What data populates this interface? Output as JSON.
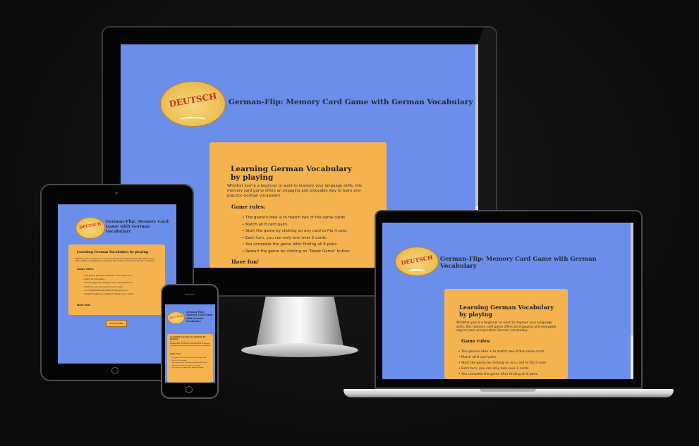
{
  "site": {
    "logo_word": "DEUTSCH",
    "title": "German-Flip: Memory Card Game with German Vocabulary",
    "card_heading": "Learning German Vocabulary by playing",
    "intro": "Whether you're a beginner or want to improve your language skills, this memory card game offers an engaging and enjoyable way to learn and practice German vocabulary.",
    "rules_heading": "Game rules:",
    "rules": [
      "The game's idea is to match two of the same cards",
      "Match all 8 card pairs.",
      "Start the game by clicking on any card to flip it over.",
      "Each turn, you can only turn over 2 cards.",
      "You complete the game after finding all 8 pairs.",
      "Restart the game by clicking on \"Reset Game\" button."
    ],
    "have_fun": "Have fun!",
    "go_button": "Go to Game"
  },
  "colors": {
    "background": "#0f0f0f",
    "site_blue": "#6a8ee9",
    "card_orange": "#f4b34f",
    "logo_red": "#c8321f"
  },
  "icons": {
    "tablet_home": "home-button-icon",
    "phone_home": "home-button-icon"
  }
}
